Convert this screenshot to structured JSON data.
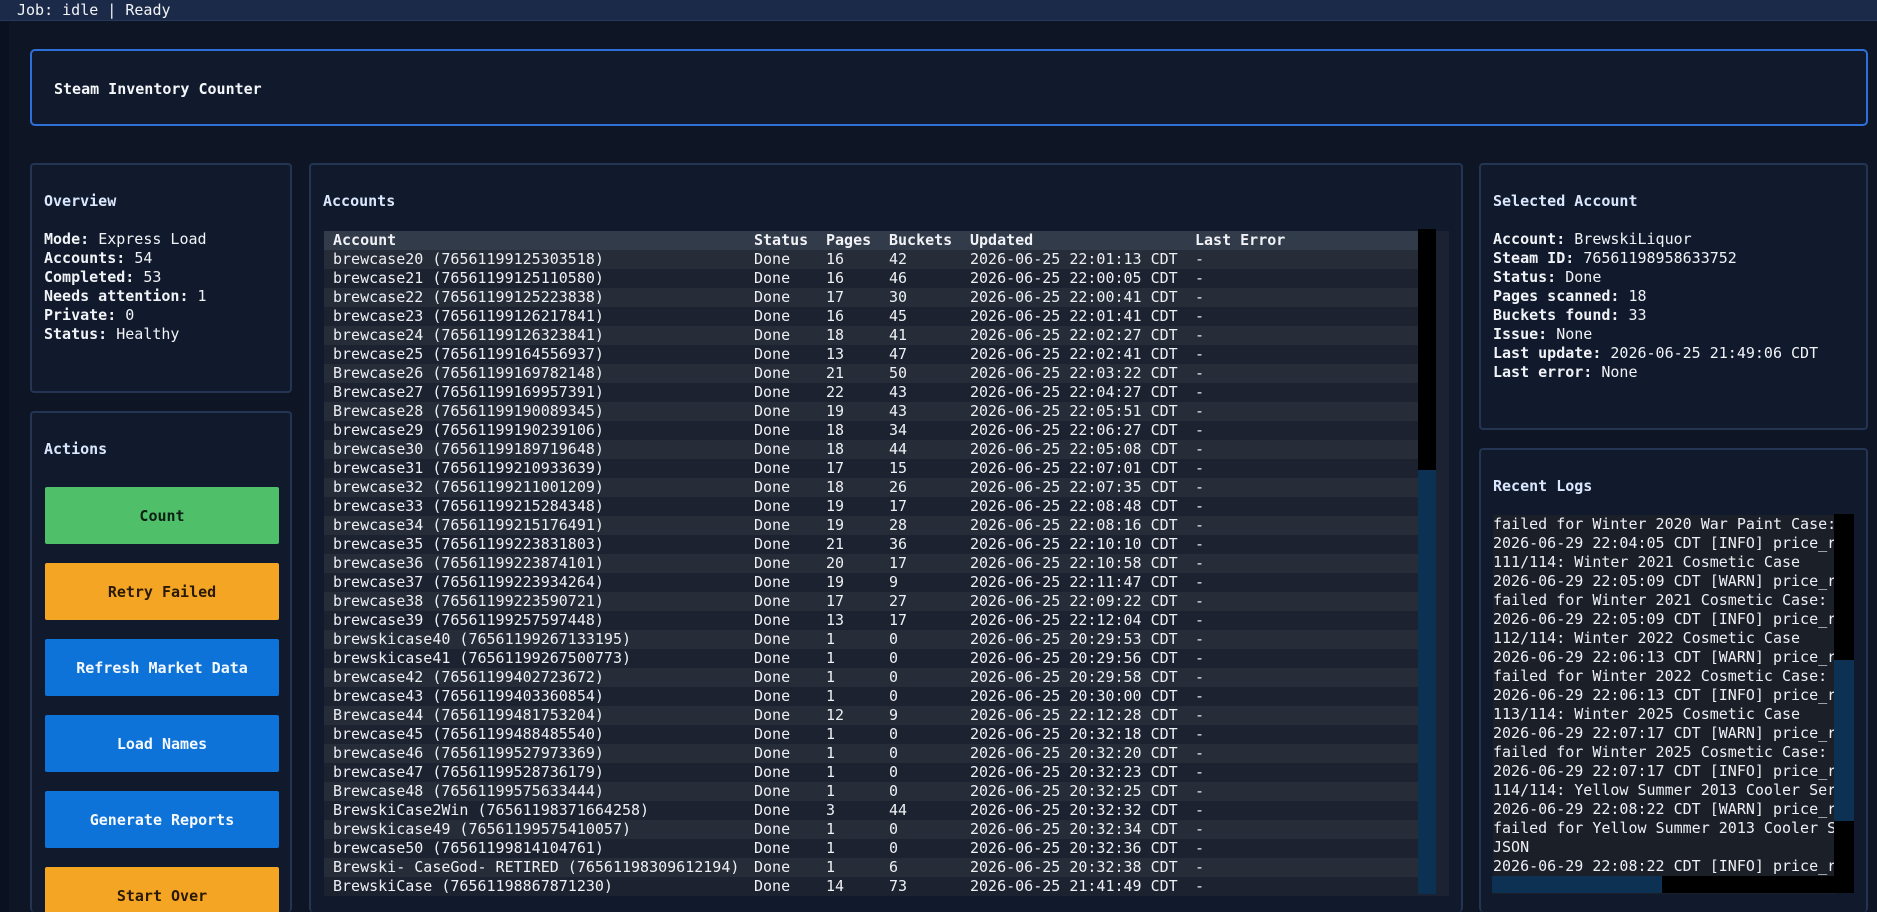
{
  "statusbar": {
    "text": "Job: idle | Ready"
  },
  "app": {
    "title": "Steam Inventory Counter"
  },
  "overview": {
    "title": "Overview",
    "items": [
      {
        "key": "Mode:",
        "value": "Express Load"
      },
      {
        "key": "Accounts:",
        "value": "54"
      },
      {
        "key": "Completed:",
        "value": "53"
      },
      {
        "key": "Needs attention:",
        "value": "1"
      },
      {
        "key": "Private:",
        "value": "0"
      },
      {
        "key": "Status:",
        "value": "Healthy"
      }
    ]
  },
  "actions": {
    "title": "Actions",
    "count": "Count",
    "retry_failed": "Retry Failed",
    "refresh_market": "Refresh Market Data",
    "load_names": "Load Names",
    "generate_reports": "Generate Reports",
    "start_over": "Start Over"
  },
  "accounts": {
    "title": "Accounts",
    "columns": [
      "Account",
      "Status",
      "Pages",
      "Buckets",
      "Updated",
      "Last Error"
    ],
    "rows": [
      [
        "brewcase20 (76561199125303518)",
        "Done",
        "16",
        "42",
        "2026-06-25 22:01:13 CDT",
        "-"
      ],
      [
        "brewcase21 (76561199125110580)",
        "Done",
        "16",
        "46",
        "2026-06-25 22:00:05 CDT",
        "-"
      ],
      [
        "brewcase22 (76561199125223838)",
        "Done",
        "17",
        "30",
        "2026-06-25 22:00:41 CDT",
        "-"
      ],
      [
        "brewcase23 (76561199126217841)",
        "Done",
        "16",
        "45",
        "2026-06-25 22:01:41 CDT",
        "-"
      ],
      [
        "brewcase24 (76561199126323841)",
        "Done",
        "18",
        "41",
        "2026-06-25 22:02:27 CDT",
        "-"
      ],
      [
        "brewcase25 (76561199164556937)",
        "Done",
        "13",
        "47",
        "2026-06-25 22:02:41 CDT",
        "-"
      ],
      [
        "Brewcase26 (76561199169782148)",
        "Done",
        "21",
        "50",
        "2026-06-25 22:03:22 CDT",
        "-"
      ],
      [
        "Brewcase27 (76561199169957391)",
        "Done",
        "22",
        "43",
        "2026-06-25 22:04:27 CDT",
        "-"
      ],
      [
        "Brewcase28 (76561199190089345)",
        "Done",
        "19",
        "43",
        "2026-06-25 22:05:51 CDT",
        "-"
      ],
      [
        "brewcase29 (76561199190239106)",
        "Done",
        "18",
        "34",
        "2026-06-25 22:06:27 CDT",
        "-"
      ],
      [
        "brewcase30 (76561199189719648)",
        "Done",
        "18",
        "44",
        "2026-06-25 22:05:08 CDT",
        "-"
      ],
      [
        "brewcase31 (76561199210933639)",
        "Done",
        "17",
        "15",
        "2026-06-25 22:07:01 CDT",
        "-"
      ],
      [
        "brewcase32 (76561199211001209)",
        "Done",
        "18",
        "26",
        "2026-06-25 22:07:35 CDT",
        "-"
      ],
      [
        "brewcase33 (76561199215284348)",
        "Done",
        "19",
        "17",
        "2026-06-25 22:08:48 CDT",
        "-"
      ],
      [
        "brewcase34 (76561199215176491)",
        "Done",
        "19",
        "28",
        "2026-06-25 22:08:16 CDT",
        "-"
      ],
      [
        "brewcase35 (76561199223831803)",
        "Done",
        "21",
        "36",
        "2026-06-25 22:10:10 CDT",
        "-"
      ],
      [
        "brewcase36 (76561199223874101)",
        "Done",
        "20",
        "17",
        "2026-06-25 22:10:58 CDT",
        "-"
      ],
      [
        "brewcase37 (76561199223934264)",
        "Done",
        "19",
        "9",
        "2026-06-25 22:11:47 CDT",
        "-"
      ],
      [
        "brewcase38 (76561199223590721)",
        "Done",
        "17",
        "27",
        "2026-06-25 22:09:22 CDT",
        "-"
      ],
      [
        "brewcase39 (76561199257597448)",
        "Done",
        "13",
        "17",
        "2026-06-25 22:12:04 CDT",
        "-"
      ],
      [
        "brewskicase40 (76561199267133195)",
        "Done",
        "1",
        "0",
        "2026-06-25 20:29:53 CDT",
        "-"
      ],
      [
        "brewskicase41 (76561199267500773)",
        "Done",
        "1",
        "0",
        "2026-06-25 20:29:56 CDT",
        "-"
      ],
      [
        "brewcase42 (76561199402723672)",
        "Done",
        "1",
        "0",
        "2026-06-25 20:29:58 CDT",
        "-"
      ],
      [
        "brewcase43 (76561199403360854)",
        "Done",
        "1",
        "0",
        "2026-06-25 20:30:00 CDT",
        "-"
      ],
      [
        "Brewcase44 (76561199481753204)",
        "Done",
        "12",
        "9",
        "2026-06-25 22:12:28 CDT",
        "-"
      ],
      [
        "brewcase45 (76561199488485540)",
        "Done",
        "1",
        "0",
        "2026-06-25 20:32:18 CDT",
        "-"
      ],
      [
        "brewcase46 (76561199527973369)",
        "Done",
        "1",
        "0",
        "2026-06-25 20:32:20 CDT",
        "-"
      ],
      [
        "brewcase47 (76561199528736179)",
        "Done",
        "1",
        "0",
        "2026-06-25 20:32:23 CDT",
        "-"
      ],
      [
        "Brewcase48 (76561199575633444)",
        "Done",
        "1",
        "0",
        "2026-06-25 20:32:25 CDT",
        "-"
      ],
      [
        "BrewskiCase2Win (76561198371664258)",
        "Done",
        "3",
        "44",
        "2026-06-25 20:32:32 CDT",
        "-"
      ],
      [
        "brewskicase49 (76561199575410057)",
        "Done",
        "1",
        "0",
        "2026-06-25 20:32:34 CDT",
        "-"
      ],
      [
        "brewcase50 (76561199814104761)",
        "Done",
        "1",
        "0",
        "2026-06-25 20:32:36 CDT",
        "-"
      ],
      [
        "Brewski- CaseGod- RETIRED (76561198309612194)",
        "Done",
        "1",
        "6",
        "2026-06-25 20:32:38 CDT",
        "-"
      ],
      [
        "BrewskiCase (76561198867871230)",
        "Done",
        "14",
        "73",
        "2026-06-25 21:41:49 CDT",
        "-"
      ]
    ]
  },
  "selected": {
    "title": "Selected Account",
    "items": [
      {
        "key": "Account:",
        "value": "BrewskiLiquor"
      },
      {
        "key": "Steam ID:",
        "value": "76561198958633752"
      },
      {
        "key": "Status:",
        "value": "Done"
      },
      {
        "key": "Pages scanned:",
        "value": "18"
      },
      {
        "key": "Buckets found:",
        "value": "33"
      },
      {
        "key": "Issue:",
        "value": "None"
      },
      {
        "key": "Last update:",
        "value": "2026-06-25 21:49:06 CDT"
      },
      {
        "key": "Last error:",
        "value": "None"
      }
    ]
  },
  "logs": {
    "title": "Recent Logs",
    "lines": [
      "failed for Winter 2020 War Paint Case:",
      "2026-06-29 22:04:05 CDT [INFO] price_r",
      "111/114: Winter 2021 Cosmetic Case",
      "2026-06-29 22:05:09 CDT [WARN] price_r",
      "failed for Winter 2021 Cosmetic Case:",
      "2026-06-29 22:05:09 CDT [INFO] price_r",
      "112/114: Winter 2022 Cosmetic Case",
      "2026-06-29 22:06:13 CDT [WARN] price_r",
      "failed for Winter 2022 Cosmetic Case:",
      "2026-06-29 22:06:13 CDT [INFO] price_r",
      "113/114: Winter 2025 Cosmetic Case",
      "2026-06-29 22:07:17 CDT [WARN] price_r",
      "failed for Winter 2025 Cosmetic Case:",
      "2026-06-29 22:07:17 CDT [INFO] price_r",
      "114/114: Yellow Summer 2013 Cooler Ser",
      "2026-06-29 22:08:22 CDT [WARN] price_r",
      "failed for Yellow Summer 2013 Cooler S",
      "JSON",
      "2026-06-29 22:08:22 CDT [INFO] price_r"
    ]
  }
}
